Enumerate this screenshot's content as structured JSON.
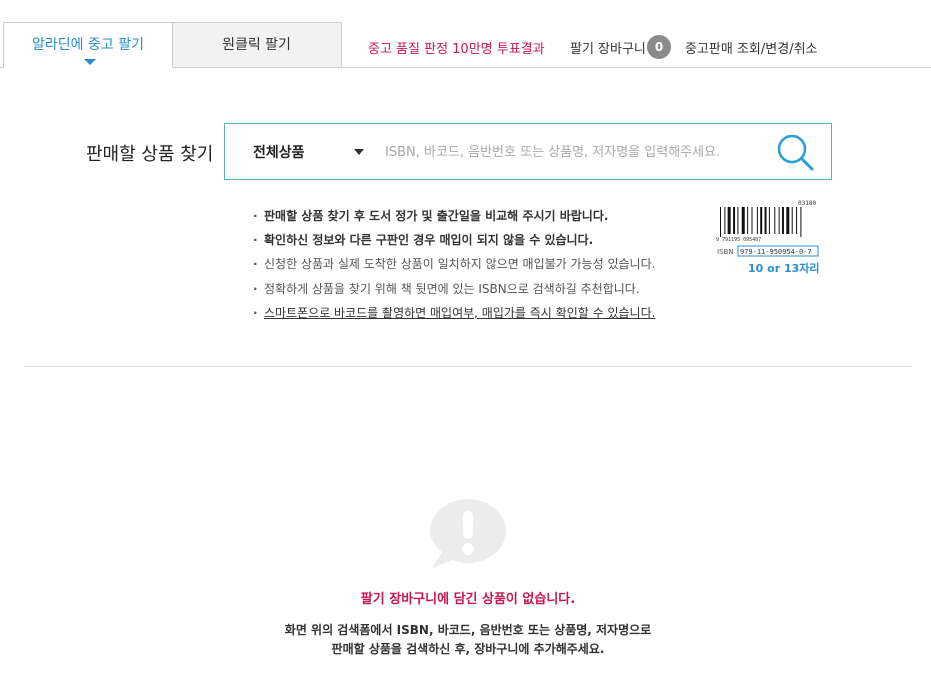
{
  "tabs": {
    "active": "알라딘에 중고 팔기",
    "inactive": "원클릭 팔기"
  },
  "top_links": {
    "vote": "중고 품질 판정 10만명 투표결과",
    "cart": "팔기 장바구니",
    "cart_count": "0",
    "orders": "중고판매 조회/변경/취소"
  },
  "search": {
    "title": "판매할 상품 찾기",
    "category": "전체상품",
    "placeholder": "ISBN, 바코드, 음반번호 또는 상품명, 저자명을 입력해주세요."
  },
  "guide": [
    "판매할 상품 찾기 후 도서 정가 및 출간일을 비교해 주시기 바랍니다.",
    "확인하신 정보와 다른 구판인 경우 매입이 되지 않을 수 있습니다.",
    "신청한 상품과 실제 도착한 상품이 일치하지 않으면 매입불가 가능성 있습니다.",
    "정확하게 상품을 찾기 위해 책 뒷면에 있는 ISBN으로 검색하길 추천합니다.",
    "스마트폰으로 바코드를 촬영하면 매입여부, 매입가를 즉시 확인할 수 있습니다."
  ],
  "barcode": {
    "top_number": "03180",
    "digits": "9 791195 095407",
    "isbn_prefix": "ISBN",
    "isbn": "979-11-950954-0-7",
    "caption": "10 or 13자리"
  },
  "empty_cart": {
    "title": "팔기 장바구니에 담긴 상품이 없습니다.",
    "line1": "화면 위의 검색폼에서 ISBN, 바코드, 음반번호 또는 상품명, 저자명으로",
    "line2": "판매할 상품을 검색하신 후, 장바구니에 추가해주세요."
  },
  "colors": {
    "accent_blue": "#2a8fc9",
    "accent_pink": "#c8174f",
    "search_border": "#5ab0c9",
    "icon_gray": "#ececec"
  }
}
